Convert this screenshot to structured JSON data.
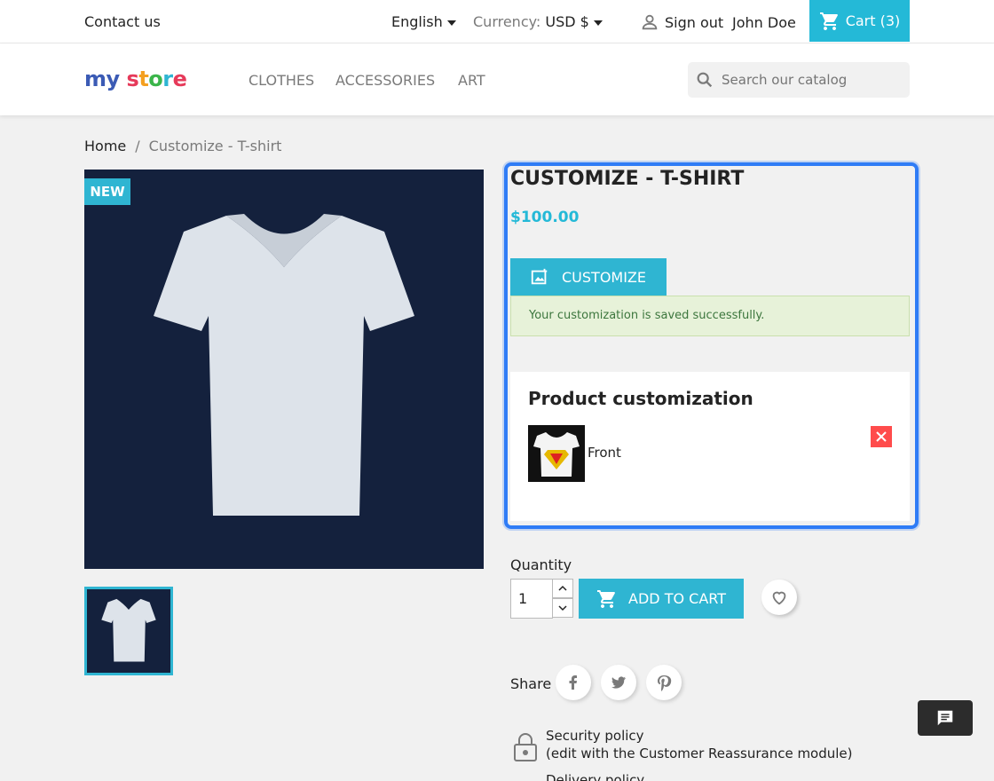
{
  "topbar": {
    "contact": "Contact us",
    "language": "English",
    "currency_label": "Currency:",
    "currency_value": "USD $",
    "sign_out": "Sign out",
    "username": "John Doe",
    "cart_label": "Cart",
    "cart_count": "(3)"
  },
  "header": {
    "logo": "my store",
    "nav": [
      "CLOTHES",
      "ACCESSORIES",
      "ART"
    ],
    "search_placeholder": "Search our catalog"
  },
  "breadcrumb": {
    "home": "Home",
    "current": "Customize - T-shirt"
  },
  "product": {
    "badge": "NEW",
    "title": "CUSTOMIZE - T-SHIRT",
    "price": "$100.00",
    "customize_button": "CUSTOMIZE",
    "alert": "Your customization is saved successfully.",
    "panel_title": "Product customization",
    "custom_item_label": "Front",
    "quantity_label": "Quantity",
    "quantity_value": "1",
    "add_to_cart": "ADD TO CART",
    "share_label": "Share"
  },
  "reassurance": {
    "line1": "Security policy",
    "line2": "(edit with the Customer Reassurance module)",
    "line3": "Delivery policy"
  },
  "colors": {
    "accent": "#2fb5d2",
    "cart_bg": "#24b9d7",
    "focus_border": "#2f7cf6",
    "alert_bg": "#e7f2d9",
    "close_red": "#ff4c4c",
    "image_bg": "#14213d"
  }
}
